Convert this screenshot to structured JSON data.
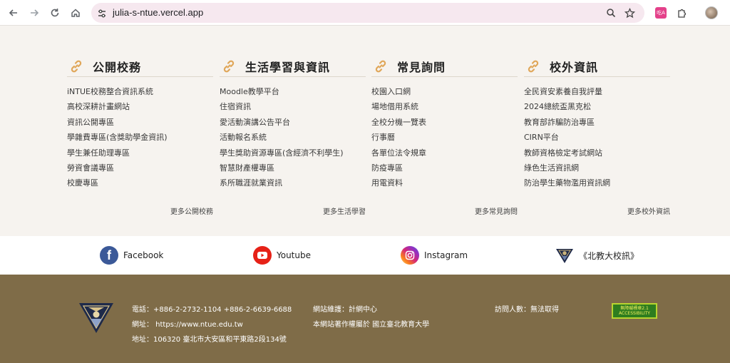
{
  "browser": {
    "url": "julia-s-ntue.vercel.app",
    "icons": [
      "back-icon",
      "forward-icon",
      "reload-icon",
      "home-icon",
      "site-settings-icon",
      "zoom-icon",
      "bookmark-star-icon",
      "extension-icon",
      "extensions-puzzle-icon",
      "profile-avatar"
    ],
    "extension_label": "吃A"
  },
  "columns": [
    {
      "title": "公開校務",
      "items": [
        "iNTUE校務整合資訊系統",
        "高校深耕計畫網站",
        "資訊公開專區",
        "學雜費專區(含獎助學金資訊)",
        "學生兼任助理專區",
        "勞資會議專區",
        "校慶專區"
      ],
      "more": "更多公開校務"
    },
    {
      "title": "生活學習與資訊",
      "items": [
        "Moodle教學平台",
        "住宿資訊",
        "愛活動演講公告平台",
        "活動報名系統",
        "學生獎助資源專區(含經濟不利學生)",
        "智慧財產權專區",
        "系所職涯就業資訊"
      ],
      "more": "更多生活學習"
    },
    {
      "title": "常見詢問",
      "items": [
        "校園入口網",
        "場地借用系統",
        "全校分機一覽表",
        "行事曆",
        "各單位法令規章",
        "防疫專區",
        "用電資料"
      ],
      "more": "更多常見詢問"
    },
    {
      "title": "校外資訊",
      "items": [
        "全民資安素養自我評量",
        "2024總統盃黑克松",
        "教育部詐騙防治專區",
        "CIRN平台",
        "教師資格檢定考試網站",
        "綠色生活資訊網",
        "防治學生藥物濫用資訊網"
      ],
      "more": "更多校外資訊"
    }
  ],
  "social": [
    {
      "label": "Facebook",
      "icon": "facebook-icon",
      "color": "#3b5998"
    },
    {
      "label": "Youtube",
      "icon": "youtube-icon",
      "color": "#e62117"
    },
    {
      "label": "Instagram",
      "icon": "instagram-icon",
      "color": "#d62976"
    },
    {
      "label": "《北教大校訊》",
      "icon": "ntue-news-logo-icon",
      "color": "#1e2a4a"
    }
  ],
  "footer": {
    "phone": "電話：+886-2-2732-1104 +886-2-6639-6688",
    "website": "網址： https://www.ntue.edu.tw",
    "address": "地址：106320 臺北市大安區和平東路2段134號",
    "maintainer": "網站維護：計網中心",
    "copyright": "本網站著作權屬於 國立臺北教育大學",
    "visitors": "訪問人數：無法取得",
    "badge_line1": "無障礙標章2.1",
    "badge_line2": "ACCESSIBILITY"
  },
  "colors": {
    "page_bg": "#f6f3ef",
    "footer_bg": "#7f6c48",
    "link_icon": "#e0a75a"
  }
}
